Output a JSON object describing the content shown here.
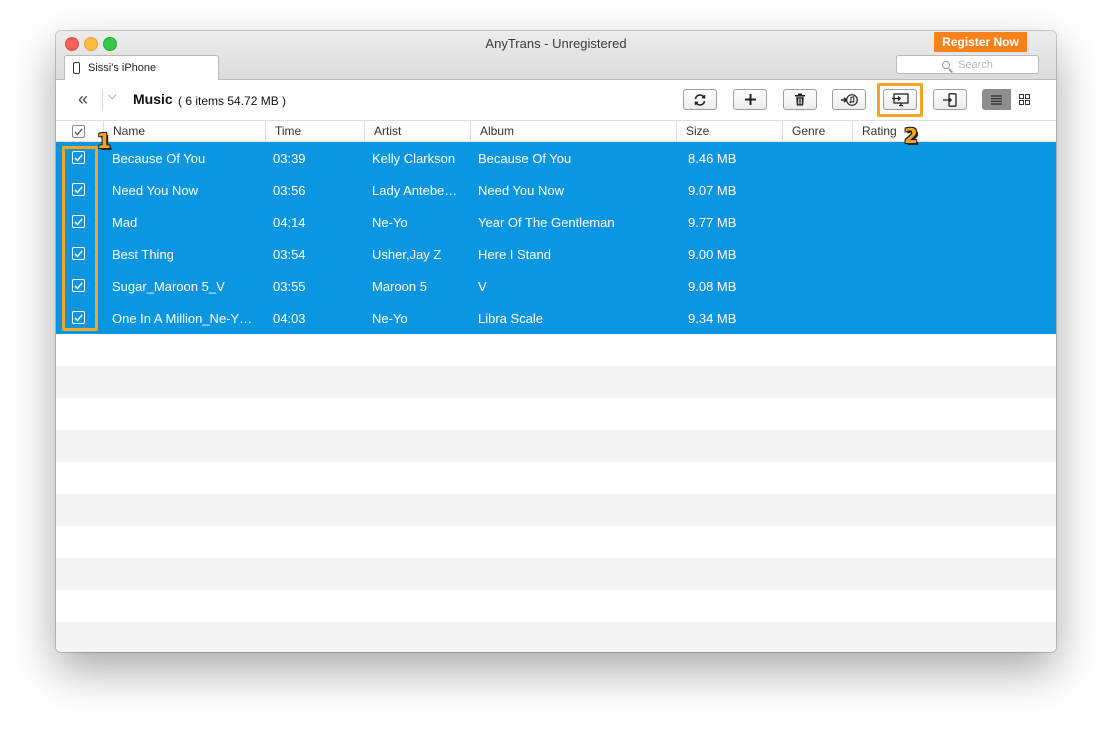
{
  "window": {
    "title": "AnyTrans - Unregistered",
    "register_label": "Register Now",
    "device_tab": "Sissi's iPhone",
    "search_placeholder": "Search"
  },
  "toolbar": {
    "section_title": "Music",
    "section_info": "( 6 items  54.72 MB )",
    "buttons": [
      "refresh-icon",
      "add-icon",
      "delete-icon",
      "add-to-itunes-icon",
      "send-to-computer-icon",
      "send-to-device-icon"
    ],
    "view_modes": [
      "list-view-icon",
      "grid-view-icon"
    ],
    "active_view": "list"
  },
  "columns": [
    "Name",
    "Time",
    "Artist",
    "Album",
    "Size",
    "Genre",
    "Rating"
  ],
  "tracks": [
    {
      "name": "Because Of You",
      "time": "03:39",
      "artist": "Kelly Clarkson",
      "album": "Because Of You",
      "size": "8.46 MB",
      "genre": "",
      "rating": "",
      "checked": true
    },
    {
      "name": "Need You Now",
      "time": "03:56",
      "artist": "Lady Antebe…",
      "album": "Need You Now",
      "size": "9.07 MB",
      "genre": "",
      "rating": "",
      "checked": true
    },
    {
      "name": "Mad",
      "time": "04:14",
      "artist": "Ne-Yo",
      "album": "Year Of The Gentleman",
      "size": "9.77 MB",
      "genre": "",
      "rating": "",
      "checked": true
    },
    {
      "name": "Best Thing",
      "time": "03:54",
      "artist": "Usher,Jay Z",
      "album": "Here I Stand",
      "size": "9.00 MB",
      "genre": "",
      "rating": "",
      "checked": true
    },
    {
      "name": "Sugar_Maroon 5_V",
      "time": "03:55",
      "artist": "Maroon 5",
      "album": "V",
      "size": "9.08 MB",
      "genre": "",
      "rating": "",
      "checked": true
    },
    {
      "name": "One In A Million_Ne-Y…",
      "time": "04:03",
      "artist": "Ne-Yo",
      "album": "Libra Scale",
      "size": "9.34 MB",
      "genre": "",
      "rating": "",
      "checked": true
    }
  ],
  "empty_rows": 10,
  "annotations": [
    "1",
    "2"
  ],
  "colors": {
    "selection": "#0c96df",
    "accent": "#f5821f",
    "annotation": "#f5a524"
  }
}
